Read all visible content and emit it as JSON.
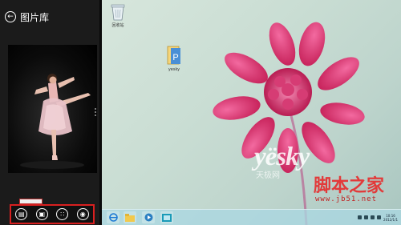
{
  "snap_app": {
    "title": "图片库",
    "appbar_buttons": [
      "slideshow",
      "set-as",
      "browse",
      "camera"
    ]
  },
  "desktop": {
    "icons": [
      {
        "name": "recycle-bin",
        "label": "回收站"
      },
      {
        "name": "folder",
        "label": "yesky"
      }
    ],
    "watermarks": {
      "yesky": "yësky",
      "sub": "天极网",
      "cn": "脚本之家",
      "url": "www.jb51.net"
    }
  },
  "taskbar": {
    "clock_time": "10:16",
    "clock_date": "2012/1/1"
  },
  "colors": {
    "highlight_border": "#d92020",
    "flower": "#e5407e",
    "taskbar": "#aad7e1"
  }
}
